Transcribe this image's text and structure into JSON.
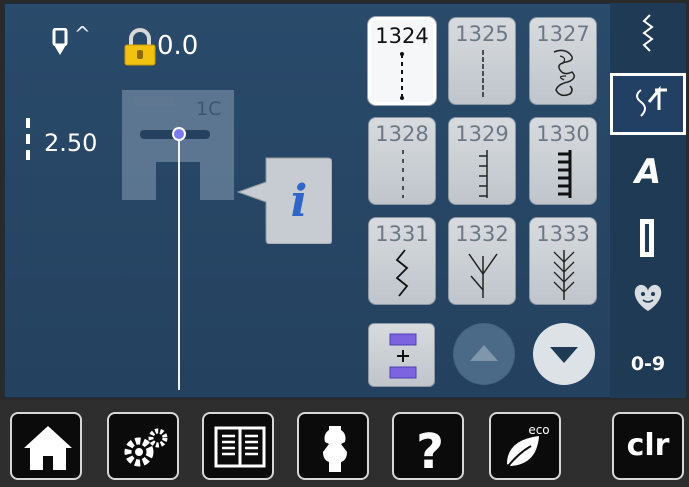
{
  "status": {
    "needle_position": "^",
    "thread_tension": "0.0",
    "stitch_length": "2.50",
    "presser_foot": "1C"
  },
  "stitches": [
    {
      "number": "1324",
      "selected": true
    },
    {
      "number": "1325",
      "selected": false
    },
    {
      "number": "1327",
      "selected": false
    },
    {
      "number": "1328",
      "selected": false
    },
    {
      "number": "1329",
      "selected": false
    },
    {
      "number": "1330",
      "selected": false
    },
    {
      "number": "1331",
      "selected": false
    },
    {
      "number": "1332",
      "selected": false
    },
    {
      "number": "1333",
      "selected": false
    }
  ],
  "sidebar": {
    "items": [
      {
        "icon": "practical-stitches-icon"
      },
      {
        "icon": "quilt-stitches-icon",
        "active": true
      },
      {
        "icon": "alphabet-icon"
      },
      {
        "icon": "buttonhole-icon"
      },
      {
        "icon": "personal-program-icon"
      },
      {
        "label": "0-9"
      }
    ]
  },
  "bottom_bar": {
    "clear_label": "clr",
    "eco_label": "eco"
  },
  "colors": {
    "screen": "#2a4a6b",
    "sidebar": "#1f3a55",
    "button": "#cfd4d9",
    "selected_button": "#f6f7f8",
    "info_accent": "#2f64c9"
  }
}
